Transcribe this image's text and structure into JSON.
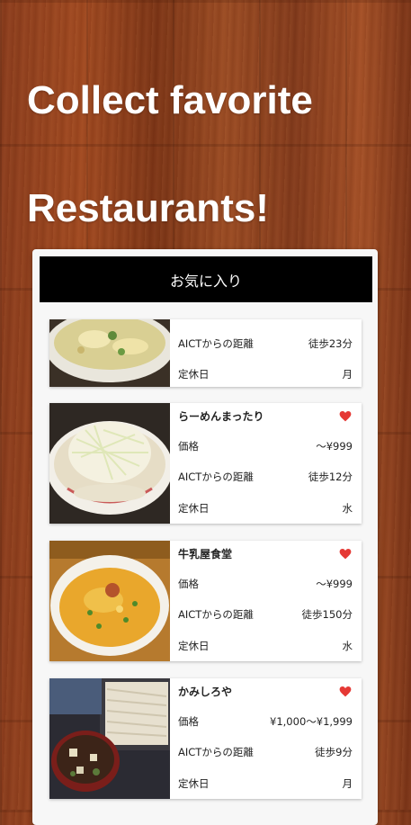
{
  "headline": {
    "line1": "Collect favorite",
    "line2": "Restaurants!"
  },
  "panel": {
    "title": "お気に入り"
  },
  "colors": {
    "heart": "#e53935",
    "header_bg": "#000000"
  },
  "labels": {
    "price": "価格",
    "distance": "AICTからの距離",
    "holiday": "定休日"
  },
  "restaurants": [
    {
      "name": "",
      "price": "",
      "distance": "徒歩23分",
      "holiday": "月",
      "favorite": false,
      "image": "ramen-bowl-photo"
    },
    {
      "name": "らーめんまったり",
      "price": "～¥999",
      "distance": "徒歩12分",
      "holiday": "水",
      "favorite": true,
      "image": "negi-ramen-photo"
    },
    {
      "name": "牛乳屋食堂",
      "price": "～¥999",
      "distance": "徒歩150分",
      "holiday": "水",
      "favorite": true,
      "image": "miso-ramen-photo"
    },
    {
      "name": "かみしろや",
      "price": "¥1,000～¥1,999",
      "distance": "徒歩9分",
      "holiday": "月",
      "favorite": true,
      "image": "soba-photo"
    }
  ]
}
